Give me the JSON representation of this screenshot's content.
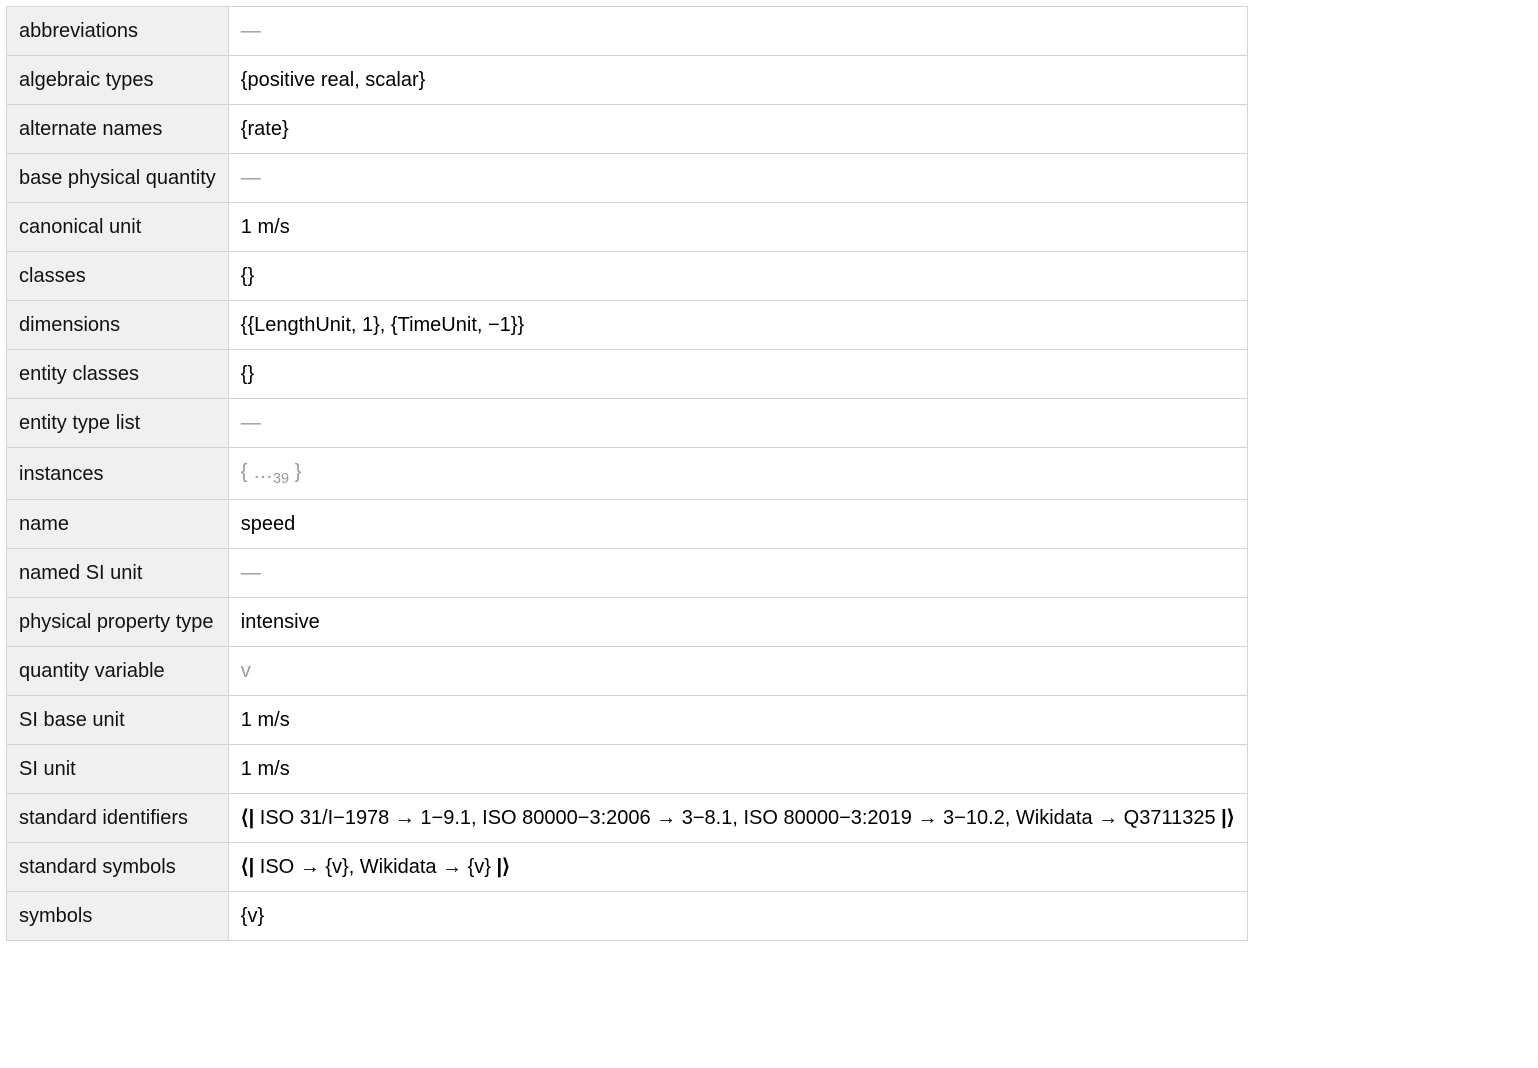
{
  "rows": [
    {
      "key": "abbreviations",
      "value": "—",
      "muted": true
    },
    {
      "key": "algebraic types",
      "value": "{positive real, scalar}"
    },
    {
      "key": "alternate names",
      "value": "{rate}"
    },
    {
      "key": "base physical quantity",
      "value": "—",
      "muted": true
    },
    {
      "key": "canonical unit",
      "value": "1 m/s"
    },
    {
      "key": "classes",
      "value": "{}"
    },
    {
      "key": "dimensions",
      "value": "{{LengthUnit, 1}, {TimeUnit, −1}}"
    },
    {
      "key": "entity classes",
      "value": "{}"
    },
    {
      "key": "entity type list",
      "value": "—",
      "muted": true
    },
    {
      "key": "instances",
      "kind": "elided",
      "elided_prefix": "{ …",
      "elided_count": "39",
      "elided_suffix": " }"
    },
    {
      "key": "name",
      "value": "speed"
    },
    {
      "key": "named SI unit",
      "value": "—",
      "muted": true
    },
    {
      "key": "physical property type",
      "value": "intensive"
    },
    {
      "key": "quantity variable",
      "value": "v",
      "muted": true
    },
    {
      "key": "SI base unit",
      "value": "1 m/s"
    },
    {
      "key": "SI unit",
      "value": "1 m/s"
    },
    {
      "key": "standard identifiers",
      "kind": "assoc",
      "assoc_open": "⟨| ",
      "assoc_body": "ISO 31/I−1978 → 1−9.1, ISO 80000−3:2006 → 3−8.1, ISO 80000−3:2019 → 3−10.2, Wikidata → Q3711325",
      "assoc_close": " |⟩"
    },
    {
      "key": "standard symbols",
      "kind": "assoc",
      "assoc_open": "⟨| ",
      "assoc_body": "ISO → {v}, Wikidata → {v}",
      "assoc_close": " |⟩"
    },
    {
      "key": "symbols",
      "value": "{v}"
    }
  ]
}
